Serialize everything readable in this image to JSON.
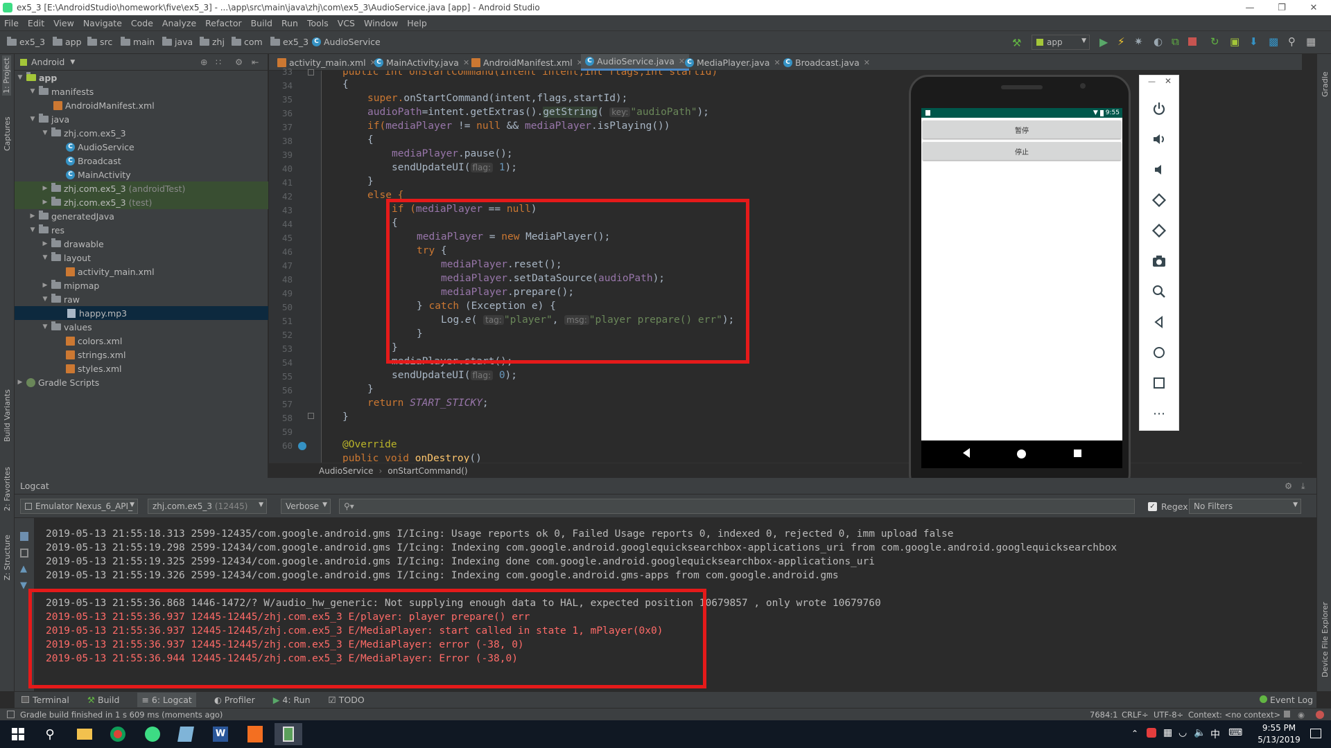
{
  "window": {
    "title": "ex5_3 [E:\\AndroidStudio\\homework\\five\\ex5_3] - ...\\app\\src\\main\\java\\zhj\\com\\ex5_3\\AudioService.java [app] - Android Studio"
  },
  "menu": [
    "File",
    "Edit",
    "View",
    "Navigate",
    "Code",
    "Analyze",
    "Refactor",
    "Build",
    "Run",
    "Tools",
    "VCS",
    "Window",
    "Help"
  ],
  "breadcrumbs": [
    "ex5_3",
    "app",
    "src",
    "main",
    "java",
    "zhj",
    "com",
    "ex5_3",
    "AudioService"
  ],
  "run_config": "app",
  "project": {
    "view_mode": "Android",
    "tree": [
      {
        "label": "app",
        "kind": "folder",
        "expanded": true
      },
      {
        "label": "manifests",
        "kind": "folder",
        "expanded": true
      },
      {
        "label": "AndroidManifest.xml",
        "kind": "xml"
      },
      {
        "label": "java",
        "kind": "folder",
        "expanded": true
      },
      {
        "label": "zhj.com.ex5_3",
        "kind": "folder",
        "expanded": true
      },
      {
        "label": "AudioService",
        "kind": "class"
      },
      {
        "label": "Broadcast",
        "kind": "class"
      },
      {
        "label": "MainActivity",
        "kind": "class"
      },
      {
        "label": "zhj.com.ex5_3",
        "suffix": "(androidTest)",
        "kind": "folder",
        "expanded": false
      },
      {
        "label": "zhj.com.ex5_3",
        "suffix": "(test)",
        "kind": "folder",
        "expanded": false
      },
      {
        "label": "generatedJava",
        "kind": "folder",
        "expanded": false
      },
      {
        "label": "res",
        "kind": "folder",
        "expanded": true
      },
      {
        "label": "drawable",
        "kind": "folder",
        "expanded": false
      },
      {
        "label": "layout",
        "kind": "folder",
        "expanded": true
      },
      {
        "label": "activity_main.xml",
        "kind": "xml"
      },
      {
        "label": "mipmap",
        "kind": "folder",
        "expanded": false
      },
      {
        "label": "raw",
        "kind": "folder",
        "expanded": true
      },
      {
        "label": "happy.mp3",
        "kind": "mp3",
        "selected": true
      },
      {
        "label": "values",
        "kind": "folder",
        "expanded": true
      },
      {
        "label": "colors.xml",
        "kind": "xml"
      },
      {
        "label": "strings.xml",
        "kind": "xml"
      },
      {
        "label": "styles.xml",
        "kind": "xml"
      },
      {
        "label": "Gradle Scripts",
        "kind": "gradle",
        "expanded": false
      }
    ]
  },
  "editor_tabs": [
    {
      "label": "activity_main.xml",
      "kind": "xml"
    },
    {
      "label": "MainActivity.java",
      "kind": "class"
    },
    {
      "label": "AndroidManifest.xml",
      "kind": "xml"
    },
    {
      "label": "AudioService.java",
      "kind": "class",
      "active": true
    },
    {
      "label": "MediaPlayer.java",
      "kind": "class"
    },
    {
      "label": "Broadcast.java",
      "kind": "class"
    }
  ],
  "line_numbers": [
    "33",
    "34",
    "35",
    "36",
    "37",
    "38",
    "39",
    "40",
    "41",
    "42",
    "43",
    "44",
    "45",
    "46",
    "47",
    "48",
    "49",
    "50",
    "51",
    "52",
    "53",
    "54",
    "55",
    "56",
    "57",
    "58",
    "59",
    "60"
  ],
  "code": {
    "l33": "public int onStartCommand(Intent intent,int flags,int startId)",
    "l34": "{",
    "l35_a": "super.",
    "l35_b": "onStartCommand",
    "l35_c": "(intent,flags,startId);",
    "l36_a": "audioPath",
    "l36_b": "=intent.getExtras().",
    "l36_c": "getString",
    "l36_d": "(",
    "l36_hint": "key:",
    "l36_str": "\"audioPath\"",
    "l36_e": ");",
    "l37_a": "if(",
    "l37_b": "mediaPlayer",
    "l37_c": " != ",
    "l37_d": "null",
    "l37_e": " && ",
    "l37_f": "mediaPlayer",
    "l37_g": ".isPlaying())",
    "l38": "{",
    "l39_a": "mediaPlayer",
    "l39_b": ".pause();",
    "l40_a": "sendUpdateUI(",
    "l40_hint": "flag:",
    "l40_num": "1",
    "l40_b": ");",
    "l41": "}",
    "l42": "else {",
    "l43_a": "if (",
    "l43_b": "mediaPlayer",
    "l43_c": " == ",
    "l43_d": "null",
    "l43_e": ")",
    "l44": "{",
    "l45_a": "mediaPlayer",
    "l45_b": " = ",
    "l45_c": "new",
    "l45_d": " MediaPlayer();",
    "l46_a": "try",
    "l46_b": " {",
    "l47_a": "mediaPlayer",
    "l47_b": ".reset();",
    "l48_a": "mediaPlayer",
    "l48_b": ".setDataSource(",
    "l48_c": "audioPath",
    "l48_d": ");",
    "l49_a": "mediaPlayer",
    "l49_b": ".prepare();",
    "l50_a": "} ",
    "l50_b": "catch",
    "l50_c": " (Exception e) {",
    "l51_a": "Log.",
    "l51_b": "e",
    "l51_c": "(",
    "l51_hint1": "tag:",
    "l51_s1": "\"player\"",
    "l51_d": ",",
    "l51_hint2": "msg:",
    "l51_s2": "\"player prepare() err\"",
    "l51_e": ");",
    "l52": "}",
    "l53": "}",
    "l54": "mediaPlayer.start();",
    "l55_a": "sendUpdateUI(",
    "l55_hint": "flag:",
    "l55_num": "0",
    "l55_b": ");",
    "l56": "}",
    "l57_a": "return",
    "l57_b": "START_STICKY",
    "l57_c": ";",
    "l58": "}",
    "l59": "",
    "l60": "@Override",
    "l61_a": "public void",
    "l61_b": "onDestroy",
    "l61_c": "()"
  },
  "editor_breadcrumb": [
    "AudioService",
    "onStartCommand()"
  ],
  "phone": {
    "status_time": "9:55",
    "buttons": [
      "暂停",
      "停止"
    ]
  },
  "logcat": {
    "title": "Logcat",
    "device": "Emulator Nexus_6_API_",
    "process": "zhj.com.ex5_3",
    "process_pid": "(12445)",
    "level": "Verbose",
    "regex_label": "Regex",
    "filter": "No Filters",
    "lines": [
      {
        "text": "2019-05-13 21:55:18.313 2599-12435/com.google.android.gms I/Icing: Usage reports ok 0, Failed Usage reports 0, indexed 0, rejected 0, imm upload false",
        "level": "info"
      },
      {
        "text": "2019-05-13 21:55:19.298 2599-12434/com.google.android.gms I/Icing: Indexing com.google.android.googlequicksearchbox-applications_uri from com.google.android.googlequicksearchbox",
        "level": "info"
      },
      {
        "text": "2019-05-13 21:55:19.325 2599-12434/com.google.android.gms I/Icing: Indexing done com.google.android.googlequicksearchbox-applications_uri",
        "level": "info"
      },
      {
        "text": "2019-05-13 21:55:19.326 2599-12434/com.google.android.gms I/Icing: Indexing com.google.android.gms-apps from com.google.android.gms",
        "level": "info"
      },
      {
        "text": "2019-05-13 21:55:36.868 1446-1472/? W/audio_hw_generic: Not supplying enough data to HAL, expected position 10679857 , only wrote 10679760",
        "level": "warn"
      },
      {
        "text": "2019-05-13 21:55:36.937 12445-12445/zhj.com.ex5_3 E/player: player prepare() err",
        "level": "error"
      },
      {
        "text": "2019-05-13 21:55:36.937 12445-12445/zhj.com.ex5_3 E/MediaPlayer: start called in state 1, mPlayer(0x0)",
        "level": "error"
      },
      {
        "text": "2019-05-13 21:55:36.937 12445-12445/zhj.com.ex5_3 E/MediaPlayer: error (-38, 0)",
        "level": "error"
      },
      {
        "text": "2019-05-13 21:55:36.944 12445-12445/zhj.com.ex5_3 E/MediaPlayer: Error (-38,0)",
        "level": "error"
      }
    ]
  },
  "bottom_tabs": [
    "Terminal",
    "Build",
    "6: Logcat",
    "Profiler",
    "4: Run",
    "TODO"
  ],
  "event_log": "Event Log",
  "left_stripe": [
    "1: Project",
    "Captures",
    "Build Variants",
    "2: Favorites",
    "Z: Structure"
  ],
  "right_stripe": [
    "Gradle",
    "Device File Explorer"
  ],
  "status": {
    "message": "Gradle build finished in 1 s 609 ms (moments ago)",
    "position": "7684:1",
    "line_sep": "CRLF÷",
    "encoding": "UTF-8÷",
    "context": "Context: <no context>"
  },
  "taskbar": {
    "time": "9:55 PM",
    "date": "5/13/2019",
    "ime": "中"
  },
  "colors": {
    "highlight_box": "#e51a1a",
    "error_text": "#ff6b68",
    "keyword": "#cc7832",
    "string": "#6a8759",
    "field": "#9876aa"
  }
}
